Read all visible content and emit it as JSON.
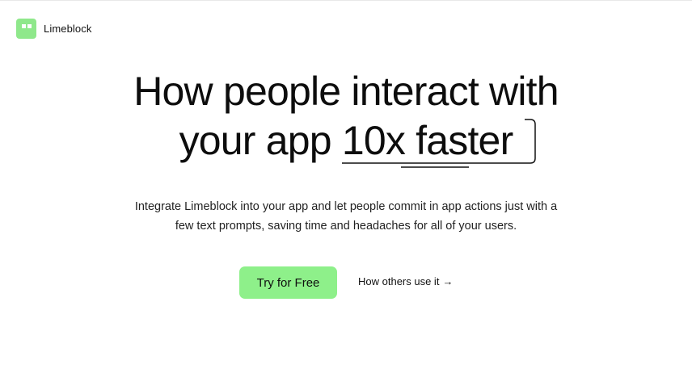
{
  "brand": {
    "name": "Limeblock",
    "logo_icon": "limeblock-logo-icon",
    "accent_color": "#8fe88b"
  },
  "hero": {
    "title_line1": "How people interact with",
    "title_line2_prefix": "your app ",
    "title_highlight": "10x faster",
    "subtitle_line1": "Integrate Limeblock into your app and let people commit in app actions just with a",
    "subtitle_line2": "few text prompts, saving time and headaches for all of your users."
  },
  "cta": {
    "primary_label": "Try for Free",
    "primary_color": "#8ef08a",
    "secondary_label": "How others use it",
    "secondary_icon": "arrow-right-icon",
    "secondary_arrow": "→"
  }
}
